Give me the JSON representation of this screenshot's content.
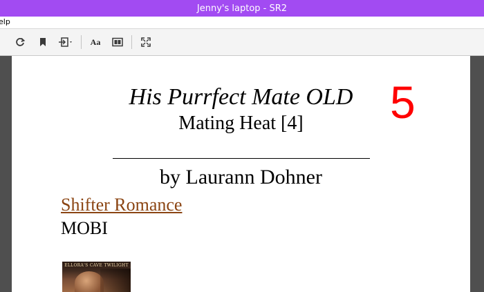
{
  "window": {
    "title": "Jenny's laptop - SR2"
  },
  "menubar": {
    "items": [
      "elp"
    ]
  },
  "toolbar": {
    "icons": [
      "refresh-icon",
      "bookmark-icon",
      "goto-icon",
      "font-icon",
      "layout-icon",
      "fullscreen-icon"
    ],
    "font_label": "Aa"
  },
  "book": {
    "title": "His Purrfect Mate OLD",
    "series": "Mating Heat [4]",
    "page_number": "5",
    "author": "by Laurann Dohner",
    "genre": "Shifter Romance",
    "format": "MOBI",
    "cover_text": "ELLORA'S CAVE TWILIGHT"
  },
  "colors": {
    "titlebar": "#a24bf2",
    "link": "#8b4513",
    "page_number": "#ff0000"
  }
}
